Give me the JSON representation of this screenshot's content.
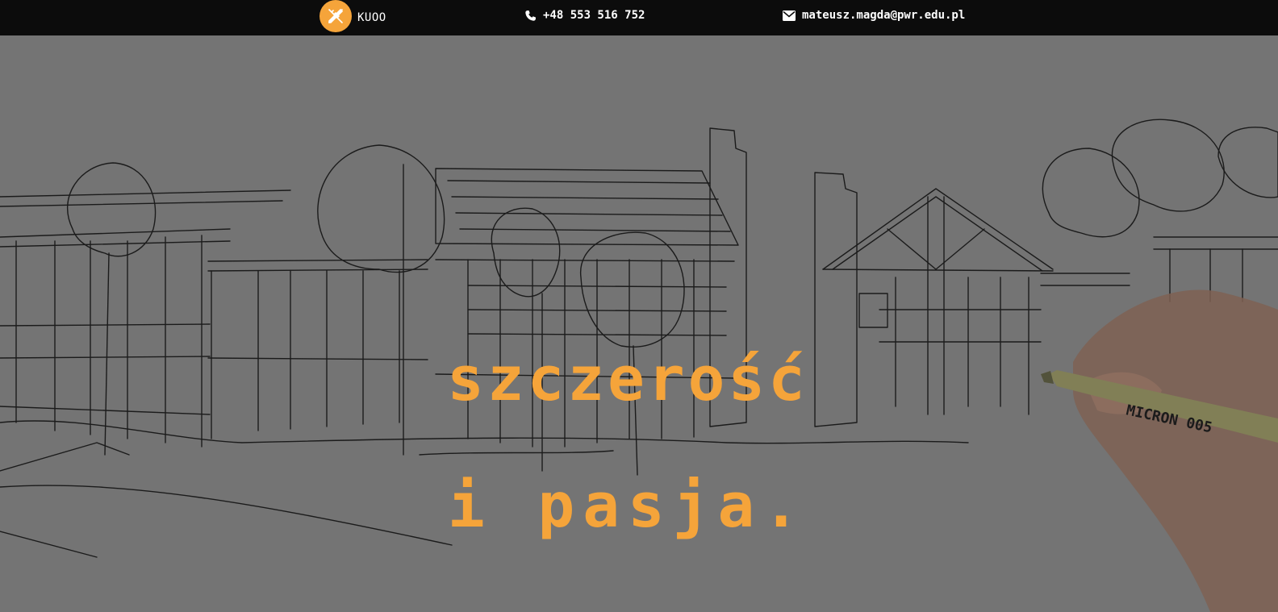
{
  "header": {
    "brand_name": "KUOO",
    "logo_icon": "pencil-ruler-icon",
    "phone_icon": "phone-icon",
    "phone": "+48 553 516 752",
    "email_icon": "envelope-icon",
    "email": "mateusz.magda@pwr.edu.pl"
  },
  "hero": {
    "line1": "szczerość",
    "line2": "i pasja.",
    "image": "architectural-sketch-with-hand-drawing-pen"
  },
  "colors": {
    "accent": "#f5a43a",
    "topbar": "#0c0c0c",
    "overlay": "#7d7d7d"
  }
}
